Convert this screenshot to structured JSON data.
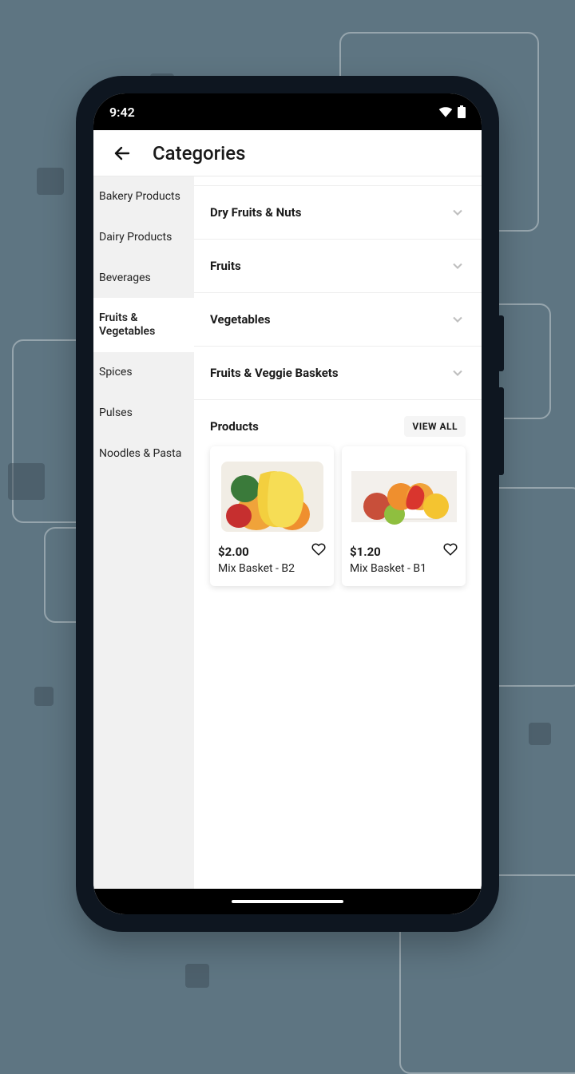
{
  "status": {
    "time": "9:42"
  },
  "header": {
    "title": "Categories"
  },
  "sidebar": {
    "items": [
      {
        "label": "Bakery Products",
        "active": false
      },
      {
        "label": "Dairy Products",
        "active": false
      },
      {
        "label": "Beverages",
        "active": false
      },
      {
        "label": "Fruits & Vegetables",
        "active": true
      },
      {
        "label": "Spices",
        "active": false
      },
      {
        "label": "Pulses",
        "active": false
      },
      {
        "label": "Noodles & Pasta",
        "active": false
      }
    ]
  },
  "accordion": {
    "items": [
      {
        "label": "Dry Fruits & Nuts"
      },
      {
        "label": "Fruits"
      },
      {
        "label": "Vegetables"
      },
      {
        "label": "Fruits & Veggie Baskets"
      }
    ]
  },
  "products": {
    "header_label": "Products",
    "view_all_label": "VIEW ALL",
    "items": [
      {
        "price": "$2.00",
        "name": "Mix Basket - B2"
      },
      {
        "price": "$1.20",
        "name": "Mix Basket - B1"
      }
    ]
  }
}
